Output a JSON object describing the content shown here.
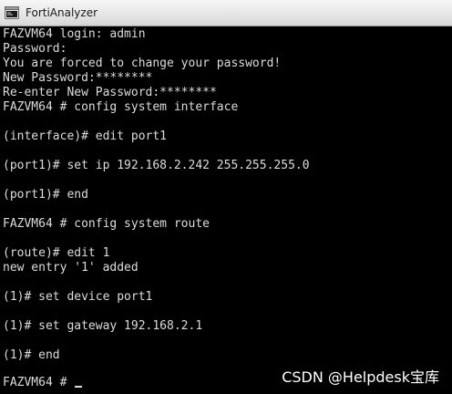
{
  "window": {
    "title": "FortiAnalyzer",
    "icon": "fortianalyzer-app-icon"
  },
  "terminal": {
    "lines": [
      "FAZVM64 login: admin",
      "Password:",
      "You are forced to change your password!",
      "New Password:********",
      "Re-enter New Password:********",
      "FAZVM64 # config system interface",
      "",
      "(interface)# edit port1",
      "",
      "(port1)# set ip 192.168.2.242 255.255.255.0",
      "",
      "(port1)# end",
      "",
      "FAZVM64 # config system route",
      "",
      "(route)# edit 1",
      "new entry '1' added",
      "",
      "(1)# set device port1",
      "",
      "(1)# set gateway 192.168.2.1",
      "",
      "(1)# end",
      "",
      "FAZVM64 # "
    ]
  },
  "watermark": "CSDN @Helpdesk宝库"
}
